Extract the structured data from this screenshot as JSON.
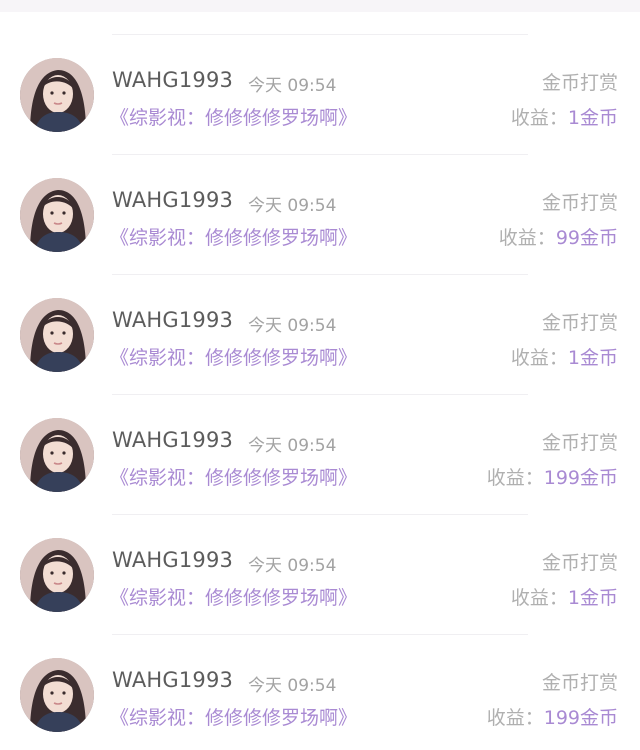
{
  "colors": {
    "accent": "#a98ad3",
    "text_primary": "#5c5c5c",
    "text_secondary": "#b0b0b0"
  },
  "records": [
    {
      "username": "WAHG1993",
      "time": "今天 09:54",
      "book_title": "《综影视：修修修修罗场啊》",
      "type": "金币打赏",
      "income_label": "收益：",
      "income_value": "1金币"
    },
    {
      "username": "WAHG1993",
      "time": "今天 09:54",
      "book_title": "《综影视：修修修修罗场啊》",
      "type": "金币打赏",
      "income_label": "收益：",
      "income_value": "99金币"
    },
    {
      "username": "WAHG1993",
      "time": "今天 09:54",
      "book_title": "《综影视：修修修修罗场啊》",
      "type": "金币打赏",
      "income_label": "收益：",
      "income_value": "1金币"
    },
    {
      "username": "WAHG1993",
      "time": "今天 09:54",
      "book_title": "《综影视：修修修修罗场啊》",
      "type": "金币打赏",
      "income_label": "收益：",
      "income_value": "199金币"
    },
    {
      "username": "WAHG1993",
      "time": "今天 09:54",
      "book_title": "《综影视：修修修修罗场啊》",
      "type": "金币打赏",
      "income_label": "收益：",
      "income_value": "1金币"
    },
    {
      "username": "WAHG1993",
      "time": "今天 09:54",
      "book_title": "《综影视：修修修修罗场啊》",
      "type": "金币打赏",
      "income_label": "收益：",
      "income_value": "199金币"
    }
  ]
}
